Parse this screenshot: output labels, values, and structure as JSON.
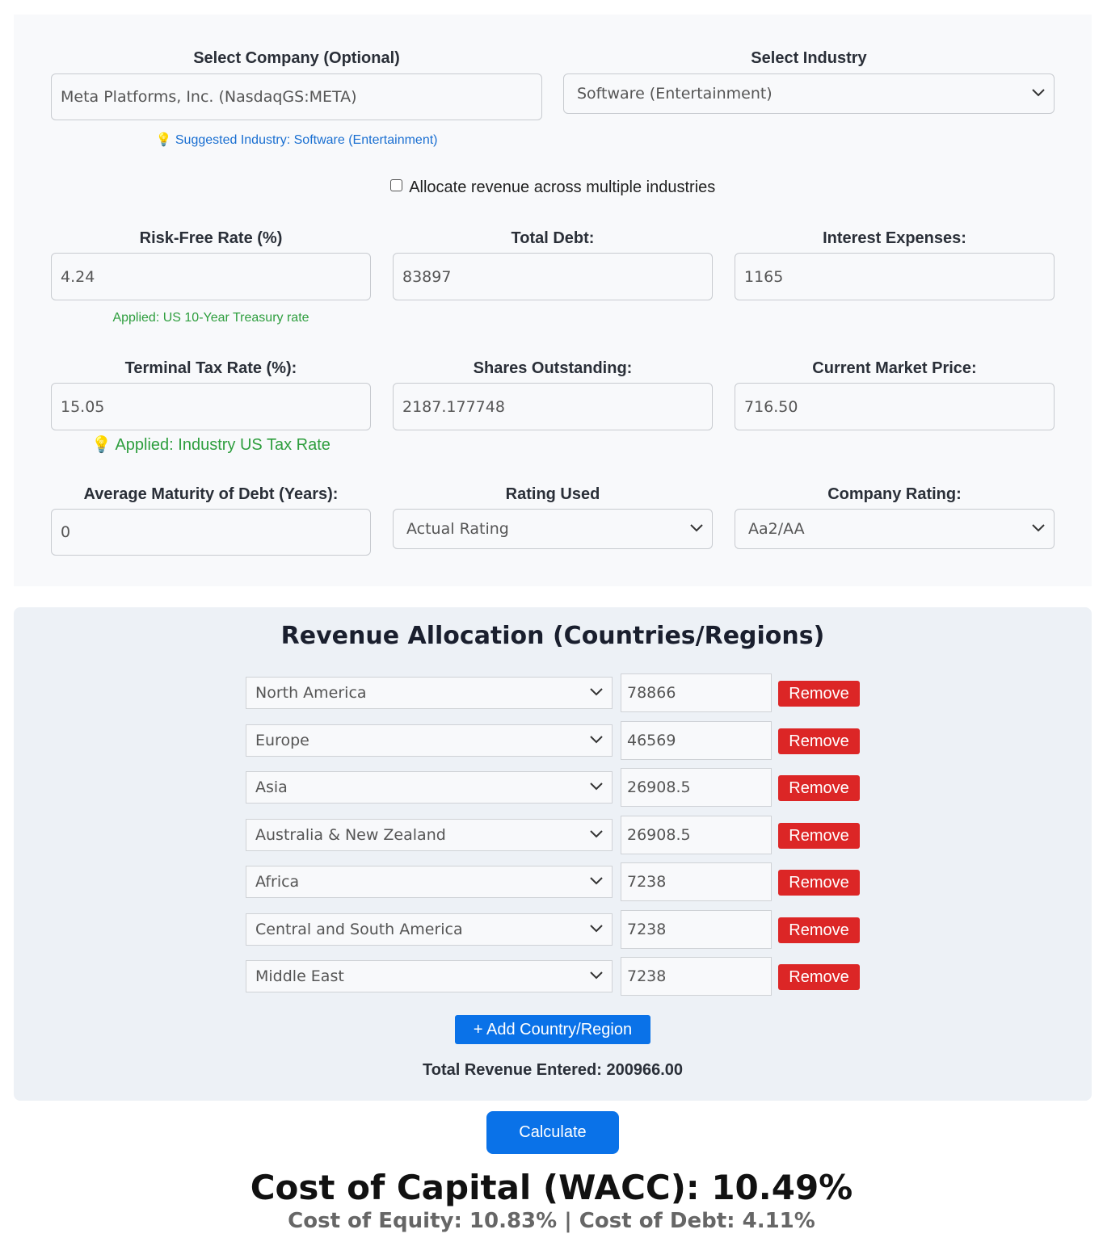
{
  "company": {
    "label": "Select Company (Optional)",
    "value": "Meta Platforms, Inc. (NasdaqGS:META)",
    "hint": "Suggested Industry: Software (Entertainment)"
  },
  "industry": {
    "label": "Select Industry",
    "selected": "Software (Entertainment)"
  },
  "allocate_checkbox": {
    "label": "Allocate revenue across multiple industries",
    "checked": false
  },
  "fields": {
    "risk_free": {
      "label": "Risk-Free Rate (%)",
      "value": "4.24",
      "hint": "Applied: US 10-Year Treasury rate"
    },
    "total_debt": {
      "label": "Total Debt:",
      "value": "83897"
    },
    "interest": {
      "label": "Interest Expenses:",
      "value": "1165"
    },
    "tax_rate": {
      "label": "Terminal Tax Rate (%):",
      "value": "15.05",
      "hint": "Applied: Industry US Tax Rate"
    },
    "shares": {
      "label": "Shares Outstanding:",
      "value": "2187.177748"
    },
    "price": {
      "label": "Current Market Price:",
      "value": "716.50"
    },
    "maturity": {
      "label": "Average Maturity of Debt (Years):",
      "value": "0"
    },
    "rating_used": {
      "label": "Rating Used",
      "selected": "Actual Rating"
    },
    "company_rating": {
      "label": "Company Rating:",
      "selected": "Aa2/AA"
    }
  },
  "revenue": {
    "title": "Revenue Allocation (Countries/Regions)",
    "remove_label": "Remove",
    "rows": [
      {
        "region": "North America",
        "value": "78866"
      },
      {
        "region": "Europe",
        "value": "46569"
      },
      {
        "region": "Asia",
        "value": "26908.5"
      },
      {
        "region": "Australia & New Zealand",
        "value": "26908.5"
      },
      {
        "region": "Africa",
        "value": "7238"
      },
      {
        "region": "Central and South America",
        "value": "7238"
      },
      {
        "region": "Middle East",
        "value": "7238"
      }
    ],
    "add_label": "+ Add Country/Region",
    "total_text": "Total Revenue Entered: 200966.00"
  },
  "calculate_label": "Calculate",
  "result": {
    "wacc_text": "Cost of Capital (WACC): 10.49%",
    "detail_text": "Cost of Equity: 10.83% | Cost of Debt: 4.11%"
  },
  "colors": {
    "primary": "#0a72e8",
    "danger": "#dc2626",
    "hint_blue": "#1a6fd1",
    "hint_green": "#2e9e3e"
  }
}
